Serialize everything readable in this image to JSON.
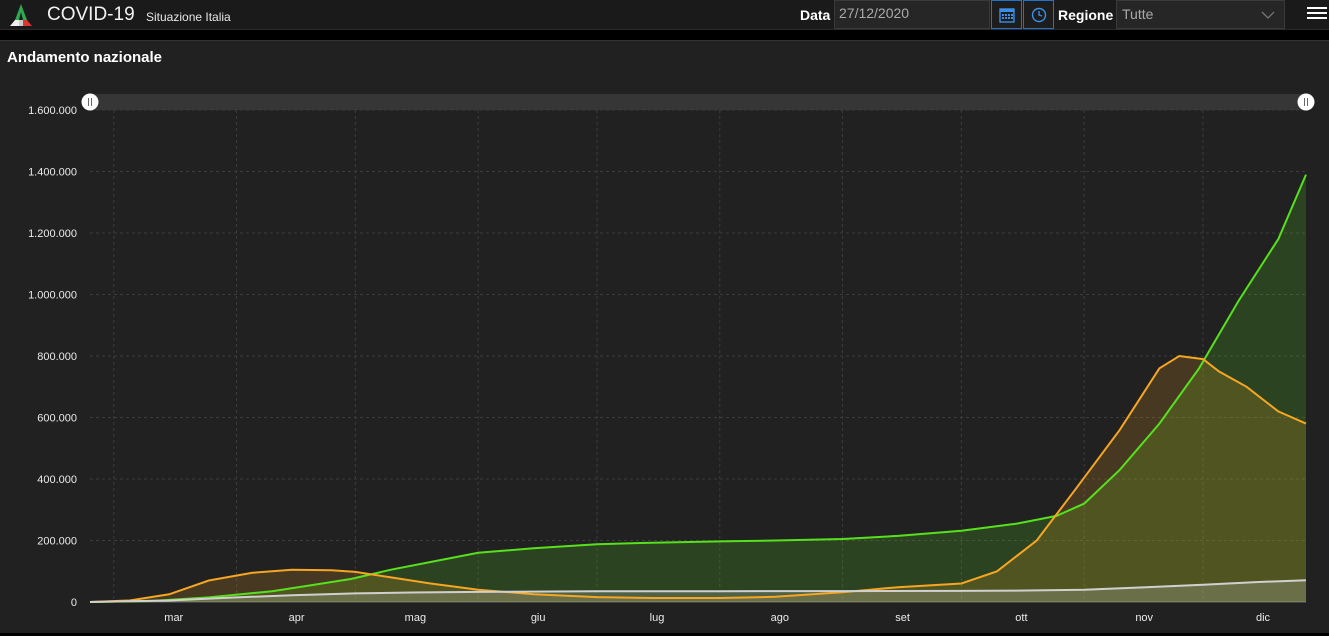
{
  "app": {
    "title": "COVID-19",
    "subtitle": "Situazione Italia"
  },
  "filters": {
    "date_label": "Data",
    "date_value": "27/12/2020",
    "region_label": "Regione",
    "region_value": "Tutte"
  },
  "icons": {
    "logo": "stacked-chart-logo-icon",
    "calendar": "calendar-icon",
    "clock": "clock-icon",
    "caret": "chevron-down-icon",
    "menu": "hamburger-menu-icon"
  },
  "colors": {
    "accent": "#1f73c9",
    "orange": "#f5a623",
    "green": "#57e01e",
    "gray": "#d0d0d0"
  },
  "panel": {
    "title": "Andamento nazionale"
  },
  "chart_data": {
    "type": "area",
    "title": "Andamento nazionale",
    "xlabel": "",
    "ylabel": "",
    "x_unit": "month (day-of-year index, 2020)",
    "xlim": [
      "2020-02-24",
      "2020-12-27"
    ],
    "ylim": [
      0,
      1600000
    ],
    "y_ticks": [
      "0",
      "200.000",
      "400.000",
      "600.000",
      "800.000",
      "1.000.000",
      "1.200.000",
      "1.400.000",
      "1.600.000"
    ],
    "x_ticks": [
      "mar",
      "apr",
      "mag",
      "giu",
      "lug",
      "ago",
      "set",
      "ott",
      "nov",
      "dic"
    ],
    "x_tick_dates": [
      "2020-03-01",
      "2020-04-01",
      "2020-05-01",
      "2020-06-01",
      "2020-07-01",
      "2020-08-01",
      "2020-09-01",
      "2020-10-01",
      "2020-11-01",
      "2020-12-01"
    ],
    "grid": true,
    "legend": "none",
    "series": [
      {
        "color": "#57e01e",
        "points": [
          [
            "2020-02-24",
            0
          ],
          [
            "2020-03-10",
            3000
          ],
          [
            "2020-03-25",
            15000
          ],
          [
            "2020-04-10",
            35000
          ],
          [
            "2020-04-20",
            55000
          ],
          [
            "2020-04-30",
            75000
          ],
          [
            "2020-05-10",
            105000
          ],
          [
            "2020-05-20",
            130000
          ],
          [
            "2020-06-01",
            160000
          ],
          [
            "2020-06-15",
            175000
          ],
          [
            "2020-07-01",
            188000
          ],
          [
            "2020-07-15",
            193000
          ],
          [
            "2020-08-01",
            197000
          ],
          [
            "2020-08-15",
            200000
          ],
          [
            "2020-09-01",
            205000
          ],
          [
            "2020-09-15",
            215000
          ],
          [
            "2020-10-01",
            232000
          ],
          [
            "2020-10-15",
            255000
          ],
          [
            "2020-10-25",
            280000
          ],
          [
            "2020-11-01",
            320000
          ],
          [
            "2020-11-10",
            430000
          ],
          [
            "2020-11-20",
            580000
          ],
          [
            "2020-11-30",
            760000
          ],
          [
            "2020-12-10",
            980000
          ],
          [
            "2020-12-20",
            1180000
          ],
          [
            "2020-12-27",
            1390000
          ]
        ]
      },
      {
        "color": "#f5a623",
        "points": [
          [
            "2020-02-24",
            0
          ],
          [
            "2020-03-05",
            5000
          ],
          [
            "2020-03-15",
            25000
          ],
          [
            "2020-03-25",
            70000
          ],
          [
            "2020-04-05",
            95000
          ],
          [
            "2020-04-15",
            105000
          ],
          [
            "2020-04-25",
            103000
          ],
          [
            "2020-05-01",
            98000
          ],
          [
            "2020-05-10",
            80000
          ],
          [
            "2020-05-20",
            60000
          ],
          [
            "2020-06-01",
            40000
          ],
          [
            "2020-06-15",
            25000
          ],
          [
            "2020-07-01",
            16000
          ],
          [
            "2020-07-15",
            13000
          ],
          [
            "2020-08-01",
            13000
          ],
          [
            "2020-08-15",
            17000
          ],
          [
            "2020-09-01",
            32000
          ],
          [
            "2020-09-15",
            48000
          ],
          [
            "2020-10-01",
            60000
          ],
          [
            "2020-10-10",
            100000
          ],
          [
            "2020-10-20",
            200000
          ],
          [
            "2020-10-30",
            370000
          ],
          [
            "2020-11-10",
            560000
          ],
          [
            "2020-11-20",
            760000
          ],
          [
            "2020-11-25",
            800000
          ],
          [
            "2020-12-01",
            790000
          ],
          [
            "2020-12-05",
            750000
          ],
          [
            "2020-12-12",
            700000
          ],
          [
            "2020-12-20",
            620000
          ],
          [
            "2020-12-27",
            580000
          ]
        ]
      },
      {
        "color": "#d0d0d0",
        "points": [
          [
            "2020-02-24",
            0
          ],
          [
            "2020-03-15",
            5000
          ],
          [
            "2020-04-01",
            15000
          ],
          [
            "2020-04-15",
            22000
          ],
          [
            "2020-05-01",
            28000
          ],
          [
            "2020-05-15",
            31000
          ],
          [
            "2020-06-01",
            33000
          ],
          [
            "2020-07-01",
            34800
          ],
          [
            "2020-08-01",
            35200
          ],
          [
            "2020-09-01",
            35500
          ],
          [
            "2020-10-01",
            36000
          ],
          [
            "2020-10-15",
            37000
          ],
          [
            "2020-11-01",
            40000
          ],
          [
            "2020-11-15",
            47000
          ],
          [
            "2020-12-01",
            56000
          ],
          [
            "2020-12-15",
            65000
          ],
          [
            "2020-12-27",
            71000
          ]
        ]
      }
    ]
  }
}
